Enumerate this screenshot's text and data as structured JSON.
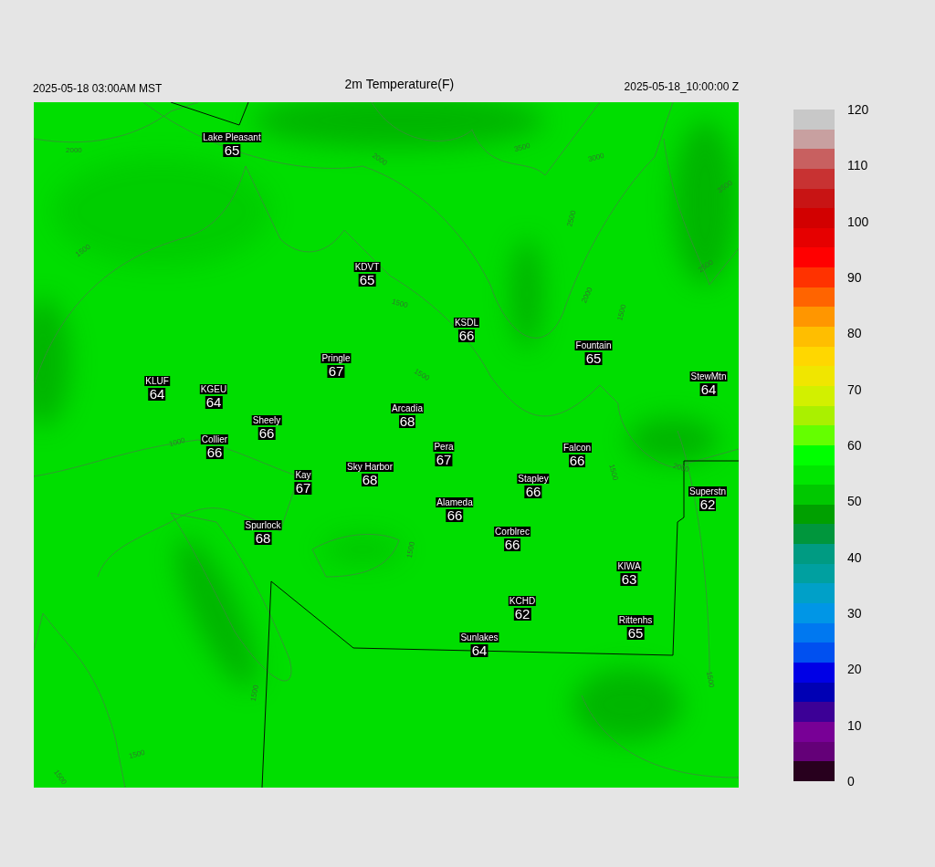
{
  "header": {
    "local_time": "2025-05-18 03:00AM MST",
    "title": "2m Temperature(F)",
    "utc_time": "2025-05-18_10:00:00 Z"
  },
  "stations": [
    {
      "name": "Lake Pleasant",
      "value": "65"
    },
    {
      "name": "KDVT",
      "value": "65"
    },
    {
      "name": "KSDL",
      "value": "66"
    },
    {
      "name": "Fountain",
      "value": "65"
    },
    {
      "name": "Pringle",
      "value": "67"
    },
    {
      "name": "StewMtn",
      "value": "64"
    },
    {
      "name": "KLUF",
      "value": "64"
    },
    {
      "name": "KGEU",
      "value": "64"
    },
    {
      "name": "Arcadia",
      "value": "68"
    },
    {
      "name": "Sheely",
      "value": "66"
    },
    {
      "name": "Collier",
      "value": "66"
    },
    {
      "name": "Pera",
      "value": "67"
    },
    {
      "name": "Falcon",
      "value": "66"
    },
    {
      "name": "Sky Harbor",
      "value": "68"
    },
    {
      "name": "Kay",
      "value": "67"
    },
    {
      "name": "Stapley",
      "value": "66"
    },
    {
      "name": "Superstn",
      "value": "62"
    },
    {
      "name": "Alameda",
      "value": "66"
    },
    {
      "name": "Spurlock",
      "value": "68"
    },
    {
      "name": "Corblrec",
      "value": "66"
    },
    {
      "name": "KIWA",
      "value": "63"
    },
    {
      "name": "KCHD",
      "value": "62"
    },
    {
      "name": "Rittenhs",
      "value": "65"
    },
    {
      "name": "Sunlakes",
      "value": "64"
    }
  ],
  "contour_labels": [
    "2000",
    "2000",
    "3500",
    "3000",
    "3500",
    "1500",
    "2500",
    "1500",
    "1500",
    "2500",
    "2000",
    "1500",
    "1000",
    "1500",
    "2000",
    "1500",
    "1500",
    "1500",
    "1500",
    "1500"
  ],
  "colorbar": {
    "ticks": [
      "120",
      "110",
      "100",
      "90",
      "80",
      "70",
      "60",
      "50",
      "40",
      "30",
      "20",
      "10",
      "0"
    ]
  }
}
